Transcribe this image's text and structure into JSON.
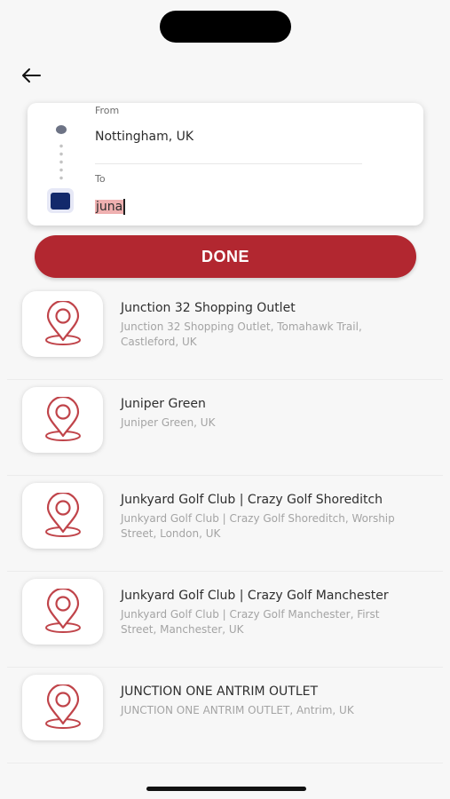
{
  "header": {
    "back_icon": "arrow-left-icon"
  },
  "route": {
    "from_label": "From",
    "from_value": "Nottingham, UK",
    "to_label": "To",
    "to_value": "juna"
  },
  "done_label": "DONE",
  "colors": {
    "accent": "#b22730",
    "to_marker": "#13296b",
    "pin": "#c0444a"
  },
  "results": [
    {
      "title": "Junction 32 Shopping Outlet",
      "subtitle": "Junction 32 Shopping Outlet, Tomahawk Trail, Castleford, UK"
    },
    {
      "title": "Juniper Green",
      "subtitle": "Juniper Green, UK"
    },
    {
      "title": "Junkyard Golf Club | Crazy Golf Shoreditch",
      "subtitle": "Junkyard Golf Club | Crazy Golf Shoreditch, Worship Street, London, UK"
    },
    {
      "title": "Junkyard Golf Club | Crazy Golf Manchester",
      "subtitle": "Junkyard Golf Club | Crazy Golf Manchester, First Street, Manchester, UK"
    },
    {
      "title": "JUNCTION ONE ANTRIM OUTLET",
      "subtitle": "JUNCTION ONE ANTRIM OUTLET, Antrim, UK"
    }
  ]
}
